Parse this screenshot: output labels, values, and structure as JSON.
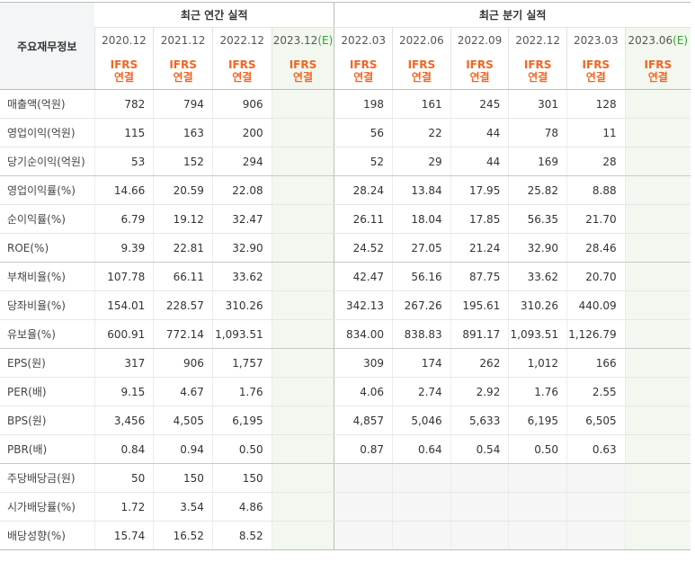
{
  "header": {
    "corner_label": "주요재무정보",
    "annual_title": "최근 연간 실적",
    "quarter_title": "최근 분기 실적",
    "annual_periods": [
      {
        "label": "2020.12",
        "mark": ""
      },
      {
        "label": "2021.12",
        "mark": ""
      },
      {
        "label": "2022.12",
        "mark": ""
      },
      {
        "label": "2023.12",
        "mark": "(E)"
      }
    ],
    "quarter_periods": [
      {
        "label": "2022.03",
        "mark": ""
      },
      {
        "label": "2022.06",
        "mark": ""
      },
      {
        "label": "2022.09",
        "mark": ""
      },
      {
        "label": "2022.12",
        "mark": ""
      },
      {
        "label": "2023.03",
        "mark": ""
      },
      {
        "label": "2023.06",
        "mark": "(E)"
      }
    ],
    "basis_line1": "IFRS",
    "basis_line2": "연결"
  },
  "rows": [
    {
      "label": "매출액(억원)",
      "annual": [
        "782",
        "794",
        "906",
        ""
      ],
      "quarter": [
        "198",
        "161",
        "245",
        "301",
        "128",
        ""
      ]
    },
    {
      "label": "영업이익(억원)",
      "annual": [
        "115",
        "163",
        "200",
        ""
      ],
      "quarter": [
        "56",
        "22",
        "44",
        "78",
        "11",
        ""
      ]
    },
    {
      "label": "당기순이익(억원)",
      "annual": [
        "53",
        "152",
        "294",
        ""
      ],
      "quarter": [
        "52",
        "29",
        "44",
        "169",
        "28",
        ""
      ]
    },
    {
      "label": "영업이익률(%)",
      "annual": [
        "14.66",
        "20.59",
        "22.08",
        ""
      ],
      "quarter": [
        "28.24",
        "13.84",
        "17.95",
        "25.82",
        "8.88",
        ""
      ]
    },
    {
      "label": "순이익률(%)",
      "annual": [
        "6.79",
        "19.12",
        "32.47",
        ""
      ],
      "quarter": [
        "26.11",
        "18.04",
        "17.85",
        "56.35",
        "21.70",
        ""
      ]
    },
    {
      "label": "ROE(%)",
      "annual": [
        "9.39",
        "22.81",
        "32.90",
        ""
      ],
      "quarter": [
        "24.52",
        "27.05",
        "21.24",
        "32.90",
        "28.46",
        ""
      ]
    },
    {
      "label": "부채비율(%)",
      "annual": [
        "107.78",
        "66.11",
        "33.62",
        ""
      ],
      "quarter": [
        "42.47",
        "56.16",
        "87.75",
        "33.62",
        "20.70",
        ""
      ]
    },
    {
      "label": "당좌비율(%)",
      "annual": [
        "154.01",
        "228.57",
        "310.26",
        ""
      ],
      "quarter": [
        "342.13",
        "267.26",
        "195.61",
        "310.26",
        "440.09",
        ""
      ]
    },
    {
      "label": "유보율(%)",
      "annual": [
        "600.91",
        "772.14",
        "1,093.51",
        ""
      ],
      "quarter": [
        "834.00",
        "838.83",
        "891.17",
        "1,093.51",
        "1,126.79",
        ""
      ]
    },
    {
      "label": "EPS(원)",
      "annual": [
        "317",
        "906",
        "1,757",
        ""
      ],
      "quarter": [
        "309",
        "174",
        "262",
        "1,012",
        "166",
        ""
      ]
    },
    {
      "label": "PER(배)",
      "annual": [
        "9.15",
        "4.67",
        "1.76",
        ""
      ],
      "quarter": [
        "4.06",
        "2.74",
        "2.92",
        "1.76",
        "2.55",
        ""
      ]
    },
    {
      "label": "BPS(원)",
      "annual": [
        "3,456",
        "4,505",
        "6,195",
        ""
      ],
      "quarter": [
        "4,857",
        "5,046",
        "5,633",
        "6,195",
        "6,505",
        ""
      ]
    },
    {
      "label": "PBR(배)",
      "annual": [
        "0.84",
        "0.94",
        "0.50",
        ""
      ],
      "quarter": [
        "0.87",
        "0.64",
        "0.54",
        "0.50",
        "0.63",
        ""
      ]
    },
    {
      "label": "주당배당금(원)",
      "annual": [
        "50",
        "150",
        "150",
        ""
      ],
      "quarter": [
        "",
        "",
        "",
        "",
        "",
        ""
      ]
    },
    {
      "label": "시가배당률(%)",
      "annual": [
        "1.72",
        "3.54",
        "4.86",
        ""
      ],
      "quarter": [
        "",
        "",
        "",
        "",
        "",
        ""
      ]
    },
    {
      "label": "배당성향(%)",
      "annual": [
        "15.74",
        "16.52",
        "8.52",
        ""
      ],
      "quarter": [
        "",
        "",
        "",
        "",
        "",
        ""
      ]
    }
  ],
  "colors": {
    "accent_orange": "#f26522",
    "estimate_green": "#31a12e",
    "estimate_bg": "#f2f8ef"
  }
}
